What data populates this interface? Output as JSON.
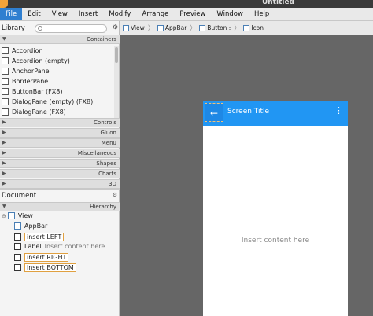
{
  "window": {
    "title": "Untitled"
  },
  "menu": [
    "File",
    "Edit",
    "View",
    "Insert",
    "Modify",
    "Arrange",
    "Preview",
    "Window",
    "Help"
  ],
  "library": {
    "title": "Library",
    "containers_label": "Containers",
    "items": [
      "Accordion",
      "Accordion  (empty)",
      "AnchorPane",
      "BorderPane",
      "ButtonBar  (FX8)",
      "DialogPane (empty)  (FX8)",
      "DialogPane  (FX8)"
    ],
    "sections": [
      "Controls",
      "Gluon",
      "Menu",
      "Miscellaneous",
      "Shapes",
      "Charts",
      "3D"
    ]
  },
  "document": {
    "title": "Document",
    "hierarchy_label": "Hierarchy"
  },
  "hierarchy": {
    "root": "View",
    "appbar": "AppBar",
    "left": "insert LEFT",
    "label_type": "Label",
    "label_text": "Insert content here",
    "right": "insert RIGHT",
    "bottom": "insert BOTTOM"
  },
  "breadcrumb": [
    "View",
    "AppBar",
    "Button :",
    "Icon"
  ],
  "preview": {
    "title": "Screen Title",
    "content": "Insert content here",
    "nav_icon": "arrow-left-icon",
    "more_icon": "more-vert-icon"
  },
  "colors": {
    "appbar": "#2196f3",
    "accent": "#2f7fd0",
    "selection": "#f0c27a"
  }
}
